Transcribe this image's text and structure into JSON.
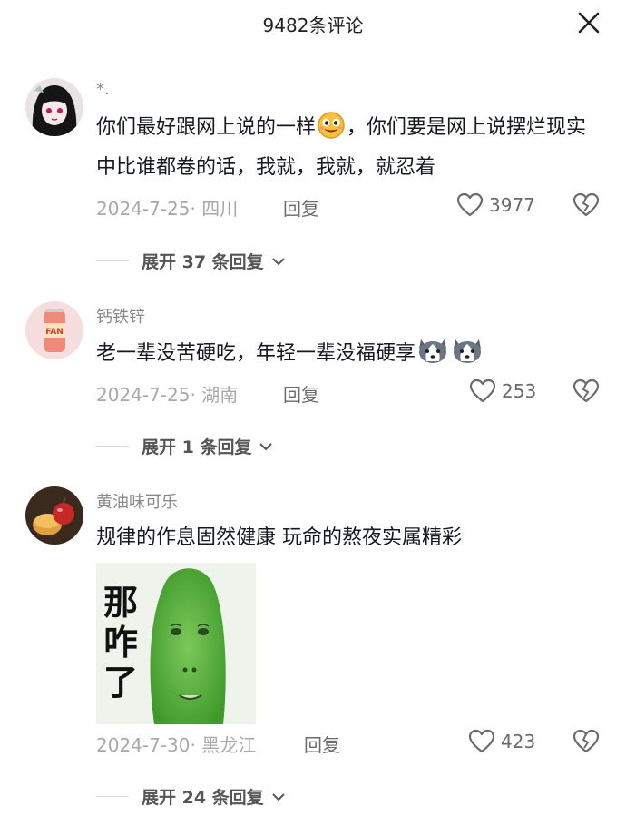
{
  "header": {
    "title": "9482条评论"
  },
  "comments": [
    {
      "username": "*.",
      "content_part1": "你们最好跟网上说的一样",
      "content_part2": "，你们要是网上说摆烂现实中比谁都卷的话，我就，我就，就忍着",
      "emoji": "grin-emoji",
      "date": "2024-7-25",
      "location": "· 四川",
      "reply_label": "回复",
      "likes": "3977",
      "expand_label": "展开 37 条回复"
    },
    {
      "username": "钙铁锌",
      "content": "老一辈没苦硬吃，年轻一辈没福硬享",
      "emoji": "husky-emoji",
      "date": "2024-7-25",
      "location": "· 湖南",
      "reply_label": "回复",
      "likes": "253",
      "expand_label": "展开 1 条回复"
    },
    {
      "username": "黄油味可乐",
      "content": "规律的作息固然健康 玩命的熬夜实属精彩",
      "sticker_text": "那咋了",
      "date": "2024-7-30",
      "location": "· 黑龙江",
      "reply_label": "回复",
      "likes": "423",
      "expand_label": "展开 24 条回复"
    }
  ],
  "colors": {
    "muted": "#a8a8ab",
    "text": "#161823",
    "sticker_green": "#5fb33a"
  }
}
